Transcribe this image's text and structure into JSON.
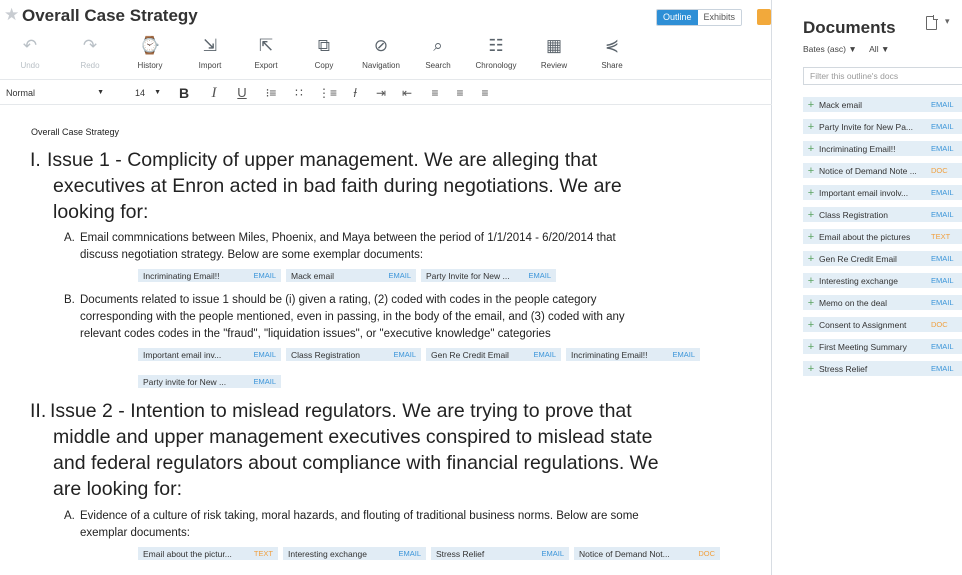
{
  "header": {
    "title": "Overall Case Strategy",
    "view_tabs": [
      "Outline",
      "Exhibits"
    ],
    "active_tab": "Outline"
  },
  "toolbar": {
    "undo": "Undo",
    "redo": "Redo",
    "history": "History",
    "import": "Import",
    "export": "Export",
    "copy": "Copy",
    "navigation": "Navigation",
    "search": "Search",
    "chronology": "Chronology",
    "review": "Review",
    "share": "Share"
  },
  "format": {
    "style": "Normal",
    "size": "14",
    "bold": "B",
    "italic": "I",
    "underline": "U"
  },
  "outline": {
    "crumb": "Overall Case Strategy",
    "issue1": {
      "num": "I.",
      "lines": [
        "Issue 1 - Complicity of upper management. We are alleging that",
        "executives at Enron acted in bad faith during negotiations. We are",
        "looking for:"
      ],
      "a_label": "A.",
      "a_lines": [
        "Email commnications between Miles, Phoenix, and Maya between the period of 1/1/2014 - 6/20/2014 that",
        "discuss negotiation strategy. Below are some exemplar documents:"
      ],
      "a_chips": [
        {
          "name": "Incriminating Email!!",
          "type": "EMAIL"
        },
        {
          "name": "Mack email",
          "type": "EMAIL"
        },
        {
          "name": "Party Invite for New ...",
          "type": "EMAIL"
        }
      ],
      "b_label": "B.",
      "b_lines": [
        "Documents related to issue 1 should be (i) given a rating, (2) coded with codes in the people category",
        "corresponding with the people mentioned, even in passing, in the body of the email, and (3) coded with any",
        "relevant codes codes in the \"fraud\", \"liquidation issues\", or \"executive knowledge\" categories"
      ],
      "b_chips_1": [
        {
          "name": "Important email inv...",
          "type": "EMAIL"
        },
        {
          "name": "Class Registration",
          "type": "EMAIL"
        },
        {
          "name": "Gen Re Credit Email",
          "type": "EMAIL"
        },
        {
          "name": "Incriminating Email!!",
          "type": "EMAIL"
        }
      ],
      "b_chips_2": [
        {
          "name": "Party invite for New ...",
          "type": "EMAIL"
        }
      ]
    },
    "issue2": {
      "num": "II.",
      "lines": [
        "Issue 2 - Intention to mislead regulators. We are trying to prove that",
        "middle and upper management executives conspired to mislead state",
        "and federal regulators about compliance with financial regulations. We",
        "are looking for:"
      ],
      "a_label": "A.",
      "a_lines": [
        "Evidence of a culture of risk taking, moral hazards, and flouting of traditional business norms. Below are some",
        "exemplar documents:"
      ],
      "a_chips": [
        {
          "name": "Email about the pictur...",
          "type": "TEXT"
        },
        {
          "name": "Interesting exchange",
          "type": "EMAIL"
        },
        {
          "name": "Stress Relief",
          "type": "EMAIL"
        },
        {
          "name": "Notice of Demand Not...",
          "type": "DOC"
        }
      ]
    }
  },
  "documents": {
    "title": "Documents",
    "sort": "Bates (asc) ▼",
    "filter_all": "All ▼",
    "filter_placeholder": "Filter this outline's docs",
    "items": [
      {
        "name": "Mack email",
        "type": "EMAIL"
      },
      {
        "name": "Party Invite for New Pa...",
        "type": "EMAIL"
      },
      {
        "name": "Incriminating Email!!",
        "type": "EMAIL"
      },
      {
        "name": "Notice of Demand Note ...",
        "type": "DOC"
      },
      {
        "name": "Important email involv...",
        "type": "EMAIL"
      },
      {
        "name": "Class Registration",
        "type": "EMAIL"
      },
      {
        "name": "Email about the pictures",
        "type": "TEXT"
      },
      {
        "name": "Gen Re Credit Email",
        "type": "EMAIL"
      },
      {
        "name": "Interesting exchange",
        "type": "EMAIL"
      },
      {
        "name": "Memo on the deal",
        "type": "EMAIL"
      },
      {
        "name": "Consent to Assignment",
        "type": "DOC"
      },
      {
        "name": "First Meeting Summary",
        "type": "EMAIL"
      },
      {
        "name": "Stress Relief",
        "type": "EMAIL"
      }
    ]
  },
  "colors": {
    "accent": "#2e8fd6",
    "chip_bg": "#e1ecf5",
    "type_email": "#3b95d9",
    "type_other": "#f0a040",
    "add_green": "#5aa360",
    "panel_toggle": "#f2a93b"
  },
  "icons": {
    "star": "star-icon",
    "undo": "undo-icon",
    "redo": "redo-icon",
    "history": "history-icon",
    "import": "import-icon",
    "export": "export-icon",
    "copy": "copy-icon",
    "navigation": "compass-icon",
    "search": "search-icon",
    "chronology": "chronology-icon",
    "review": "review-icon",
    "share": "share-icon",
    "add": "plus-icon",
    "new_document": "new-document-icon"
  }
}
